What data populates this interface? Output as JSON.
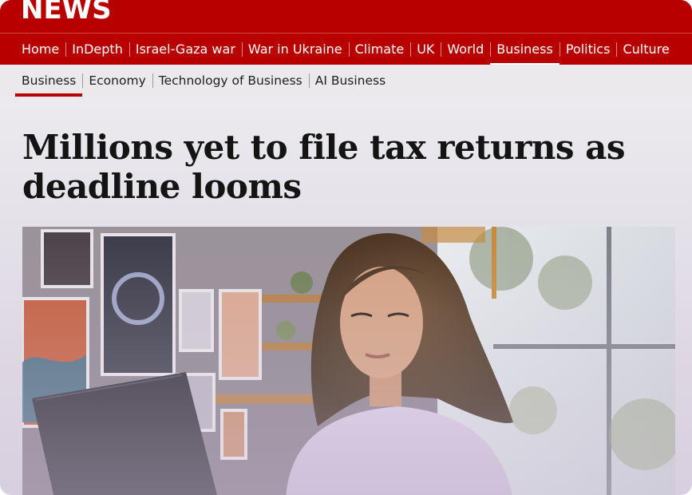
{
  "brand": {
    "logo_text": "NEWS",
    "accent_color": "#b80000"
  },
  "primary_nav": {
    "items": [
      {
        "label": "Home",
        "active": false
      },
      {
        "label": "InDepth",
        "active": false
      },
      {
        "label": "Israel-Gaza war",
        "active": false
      },
      {
        "label": "War in Ukraine",
        "active": false
      },
      {
        "label": "Climate",
        "active": false
      },
      {
        "label": "UK",
        "active": false
      },
      {
        "label": "World",
        "active": false
      },
      {
        "label": "Business",
        "active": true
      },
      {
        "label": "Politics",
        "active": false
      },
      {
        "label": "Culture",
        "active": false
      }
    ]
  },
  "secondary_nav": {
    "items": [
      {
        "label": "Business",
        "active": true
      },
      {
        "label": "Economy",
        "active": false
      },
      {
        "label": "Technology of Business",
        "active": false
      },
      {
        "label": "AI Business",
        "active": false
      }
    ]
  },
  "article": {
    "headline": "Millions yet to file tax returns as deadline looms"
  }
}
